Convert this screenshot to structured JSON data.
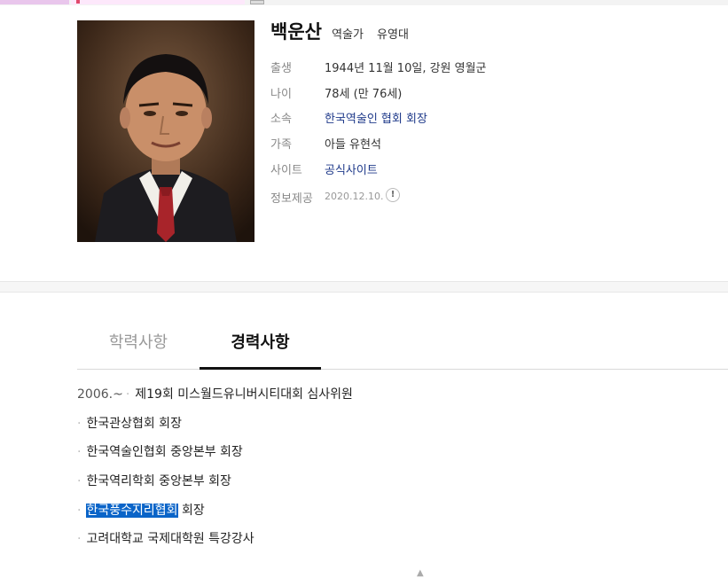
{
  "profile": {
    "name": "백운산",
    "occupation": "역술가",
    "alias": "유영대",
    "rows": [
      {
        "label": "출생",
        "value": "1944년 11월 10일, 강원 영월군"
      },
      {
        "label": "나이",
        "value": "78세 (만 76세)"
      },
      {
        "label": "소속",
        "value": "한국역술인 협회 회장"
      },
      {
        "label": "가족",
        "value": "아들 유현석"
      },
      {
        "label": "사이트",
        "value": "공식사이트"
      },
      {
        "label": "정보제공",
        "value": "2020.12.10."
      }
    ]
  },
  "tabs": [
    {
      "label": "학력사항",
      "active": false
    },
    {
      "label": "경력사항",
      "active": true
    }
  ],
  "career": [
    {
      "period": "2006.~",
      "text": "제19회 미스월드유니버시티대회 심사위원"
    },
    {
      "period": "",
      "text": "한국관상협회 회장"
    },
    {
      "period": "",
      "text": "한국역술인협회 중앙본부 회장"
    },
    {
      "period": "",
      "text": "한국역리학회 중앙본부 회장"
    },
    {
      "period": "",
      "highlight": "한국풍수지리협회",
      "text": " 회장"
    },
    {
      "period": "",
      "text": "고려대학교 국제대학원 특강강사"
    }
  ],
  "colors": {
    "link": "#1f3a8a",
    "selection": "#0a64c8",
    "label": "#888888"
  },
  "icons": {
    "report": "exclamation-circle-icon"
  }
}
